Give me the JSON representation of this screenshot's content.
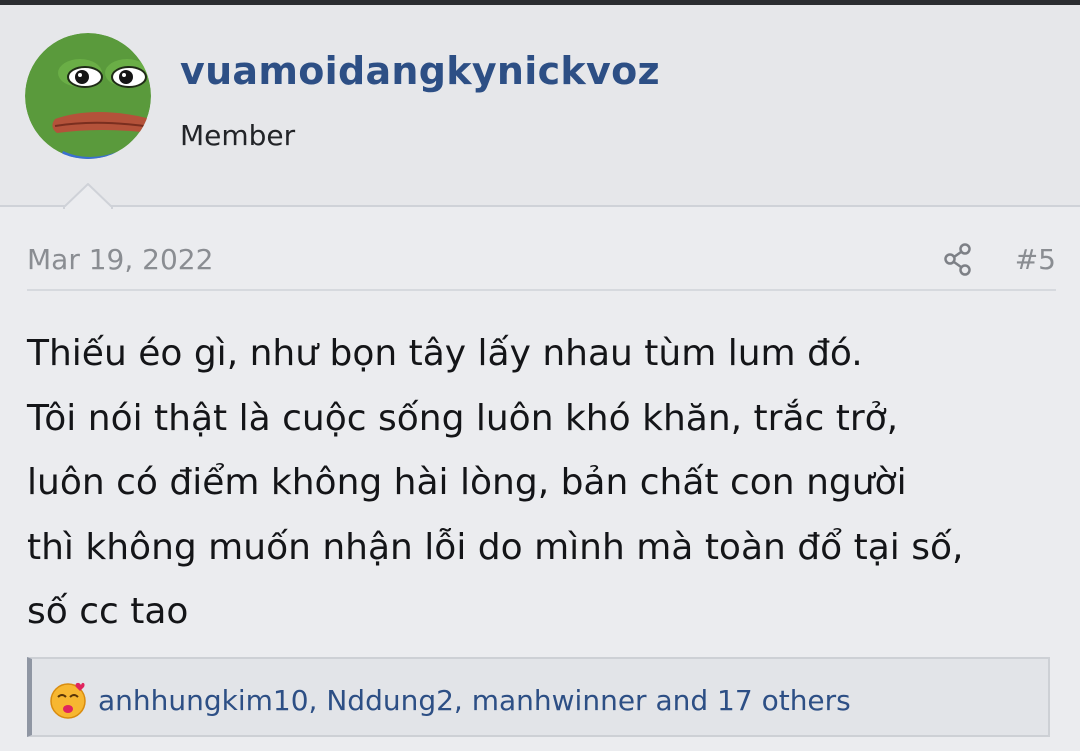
{
  "user": {
    "username": "vuamoidangkynickvoz",
    "title": "Member"
  },
  "post": {
    "date": "Mar 19, 2022",
    "number": "#5",
    "lines": [
      "Thiếu éo gì, như bọn tây lấy nhau tùm lum đó.",
      "Tôi nói thật là cuộc sống luôn khó khăn, trắc trở,",
      "luôn có điểm không hài lòng, bản chất con người",
      "thì không muốn nhận lỗi do mình mà toàn đổ tại số,",
      "số cc tao"
    ]
  },
  "reactions": {
    "text": "anhhungkim10, Nddung2, manhwinner and 17 others"
  },
  "icons": {
    "avatar": "pepe-frog-avatar",
    "share": "share-icon",
    "reaction": "kiss-emoji-icon"
  },
  "colors": {
    "link": "#2d4f85",
    "muted": "#8a8d92",
    "background": "#ebecef",
    "header_background": "#e6e7ea"
  }
}
